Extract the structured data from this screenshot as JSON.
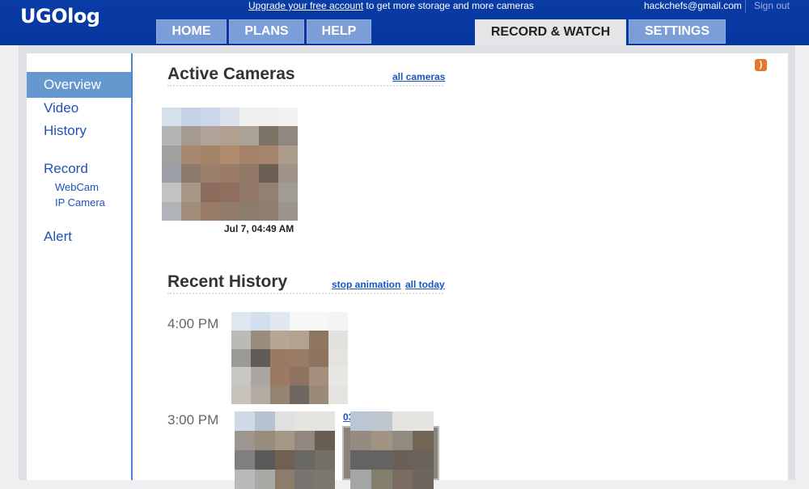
{
  "header": {
    "logo": "UGOlog",
    "upgrade_link": "Upgrade your free account",
    "upgrade_text": " to get more storage and more cameras",
    "user_email": "hackchefs@gmail.com",
    "sign_out": "Sign out",
    "tabs": [
      {
        "label": "HOME",
        "active": false
      },
      {
        "label": "PLANS",
        "active": false
      },
      {
        "label": "HELP",
        "active": false
      },
      {
        "label": "RECORD & WATCH",
        "active": true
      },
      {
        "label": "SETTINGS",
        "active": false
      }
    ]
  },
  "sidebar": {
    "items": [
      {
        "label": "Overview",
        "active": true
      },
      {
        "label": "Video"
      },
      {
        "label": "History"
      },
      {
        "label": "Record"
      },
      {
        "label": "WebCam",
        "sub": true
      },
      {
        "label": "IP Camera",
        "sub": true
      },
      {
        "label": "Alert"
      }
    ]
  },
  "active_cameras": {
    "title": "Active Cameras",
    "all_link": "all cameras",
    "cameras": [
      {
        "caption": "Jul 7, 04:49 AM"
      }
    ]
  },
  "recent_history": {
    "title": "Recent History",
    "stop_link": "stop animation",
    "all_link": "all today",
    "groups": [
      {
        "time": "4:00 PM"
      },
      {
        "time": "3:00 PM",
        "partial_link": "03"
      }
    ]
  },
  "icons": {
    "rss": "rss-feed-icon"
  },
  "colors": {
    "header": "#06359e",
    "tab": "#7b9dd8",
    "active_nav": "#6698cf",
    "link": "#1a55bd",
    "rss": "#e6772e"
  }
}
